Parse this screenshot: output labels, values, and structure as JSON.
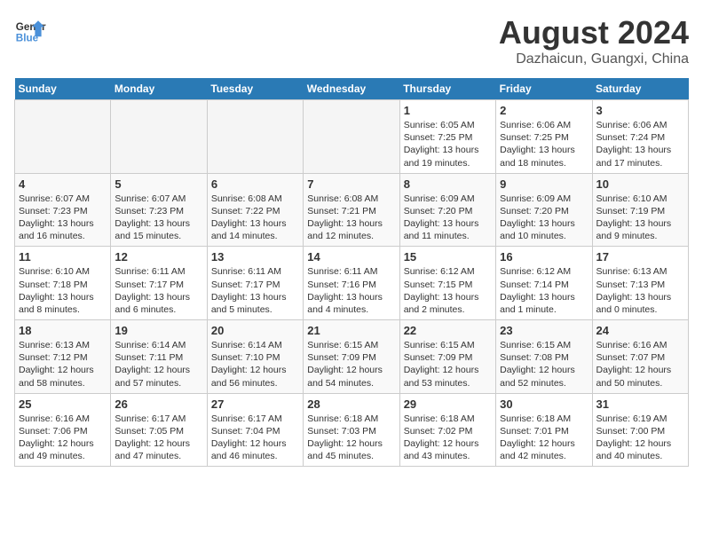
{
  "logo": {
    "line1": "General",
    "line2": "Blue"
  },
  "title": "August 2024",
  "subtitle": "Dazhaicun, Guangxi, China",
  "days_of_week": [
    "Sunday",
    "Monday",
    "Tuesday",
    "Wednesday",
    "Thursday",
    "Friday",
    "Saturday"
  ],
  "weeks": [
    [
      {
        "day": "",
        "info": ""
      },
      {
        "day": "",
        "info": ""
      },
      {
        "day": "",
        "info": ""
      },
      {
        "day": "",
        "info": ""
      },
      {
        "day": "1",
        "info": "Sunrise: 6:05 AM\nSunset: 7:25 PM\nDaylight: 13 hours and 19 minutes."
      },
      {
        "day": "2",
        "info": "Sunrise: 6:06 AM\nSunset: 7:25 PM\nDaylight: 13 hours and 18 minutes."
      },
      {
        "day": "3",
        "info": "Sunrise: 6:06 AM\nSunset: 7:24 PM\nDaylight: 13 hours and 17 minutes."
      }
    ],
    [
      {
        "day": "4",
        "info": "Sunrise: 6:07 AM\nSunset: 7:23 PM\nDaylight: 13 hours and 16 minutes."
      },
      {
        "day": "5",
        "info": "Sunrise: 6:07 AM\nSunset: 7:23 PM\nDaylight: 13 hours and 15 minutes."
      },
      {
        "day": "6",
        "info": "Sunrise: 6:08 AM\nSunset: 7:22 PM\nDaylight: 13 hours and 14 minutes."
      },
      {
        "day": "7",
        "info": "Sunrise: 6:08 AM\nSunset: 7:21 PM\nDaylight: 13 hours and 12 minutes."
      },
      {
        "day": "8",
        "info": "Sunrise: 6:09 AM\nSunset: 7:20 PM\nDaylight: 13 hours and 11 minutes."
      },
      {
        "day": "9",
        "info": "Sunrise: 6:09 AM\nSunset: 7:20 PM\nDaylight: 13 hours and 10 minutes."
      },
      {
        "day": "10",
        "info": "Sunrise: 6:10 AM\nSunset: 7:19 PM\nDaylight: 13 hours and 9 minutes."
      }
    ],
    [
      {
        "day": "11",
        "info": "Sunrise: 6:10 AM\nSunset: 7:18 PM\nDaylight: 13 hours and 8 minutes."
      },
      {
        "day": "12",
        "info": "Sunrise: 6:11 AM\nSunset: 7:17 PM\nDaylight: 13 hours and 6 minutes."
      },
      {
        "day": "13",
        "info": "Sunrise: 6:11 AM\nSunset: 7:17 PM\nDaylight: 13 hours and 5 minutes."
      },
      {
        "day": "14",
        "info": "Sunrise: 6:11 AM\nSunset: 7:16 PM\nDaylight: 13 hours and 4 minutes."
      },
      {
        "day": "15",
        "info": "Sunrise: 6:12 AM\nSunset: 7:15 PM\nDaylight: 13 hours and 2 minutes."
      },
      {
        "day": "16",
        "info": "Sunrise: 6:12 AM\nSunset: 7:14 PM\nDaylight: 13 hours and 1 minute."
      },
      {
        "day": "17",
        "info": "Sunrise: 6:13 AM\nSunset: 7:13 PM\nDaylight: 13 hours and 0 minutes."
      }
    ],
    [
      {
        "day": "18",
        "info": "Sunrise: 6:13 AM\nSunset: 7:12 PM\nDaylight: 12 hours and 58 minutes."
      },
      {
        "day": "19",
        "info": "Sunrise: 6:14 AM\nSunset: 7:11 PM\nDaylight: 12 hours and 57 minutes."
      },
      {
        "day": "20",
        "info": "Sunrise: 6:14 AM\nSunset: 7:10 PM\nDaylight: 12 hours and 56 minutes."
      },
      {
        "day": "21",
        "info": "Sunrise: 6:15 AM\nSunset: 7:09 PM\nDaylight: 12 hours and 54 minutes."
      },
      {
        "day": "22",
        "info": "Sunrise: 6:15 AM\nSunset: 7:09 PM\nDaylight: 12 hours and 53 minutes."
      },
      {
        "day": "23",
        "info": "Sunrise: 6:15 AM\nSunset: 7:08 PM\nDaylight: 12 hours and 52 minutes."
      },
      {
        "day": "24",
        "info": "Sunrise: 6:16 AM\nSunset: 7:07 PM\nDaylight: 12 hours and 50 minutes."
      }
    ],
    [
      {
        "day": "25",
        "info": "Sunrise: 6:16 AM\nSunset: 7:06 PM\nDaylight: 12 hours and 49 minutes."
      },
      {
        "day": "26",
        "info": "Sunrise: 6:17 AM\nSunset: 7:05 PM\nDaylight: 12 hours and 47 minutes."
      },
      {
        "day": "27",
        "info": "Sunrise: 6:17 AM\nSunset: 7:04 PM\nDaylight: 12 hours and 46 minutes."
      },
      {
        "day": "28",
        "info": "Sunrise: 6:18 AM\nSunset: 7:03 PM\nDaylight: 12 hours and 45 minutes."
      },
      {
        "day": "29",
        "info": "Sunrise: 6:18 AM\nSunset: 7:02 PM\nDaylight: 12 hours and 43 minutes."
      },
      {
        "day": "30",
        "info": "Sunrise: 6:18 AM\nSunset: 7:01 PM\nDaylight: 12 hours and 42 minutes."
      },
      {
        "day": "31",
        "info": "Sunrise: 6:19 AM\nSunset: 7:00 PM\nDaylight: 12 hours and 40 minutes."
      }
    ]
  ]
}
